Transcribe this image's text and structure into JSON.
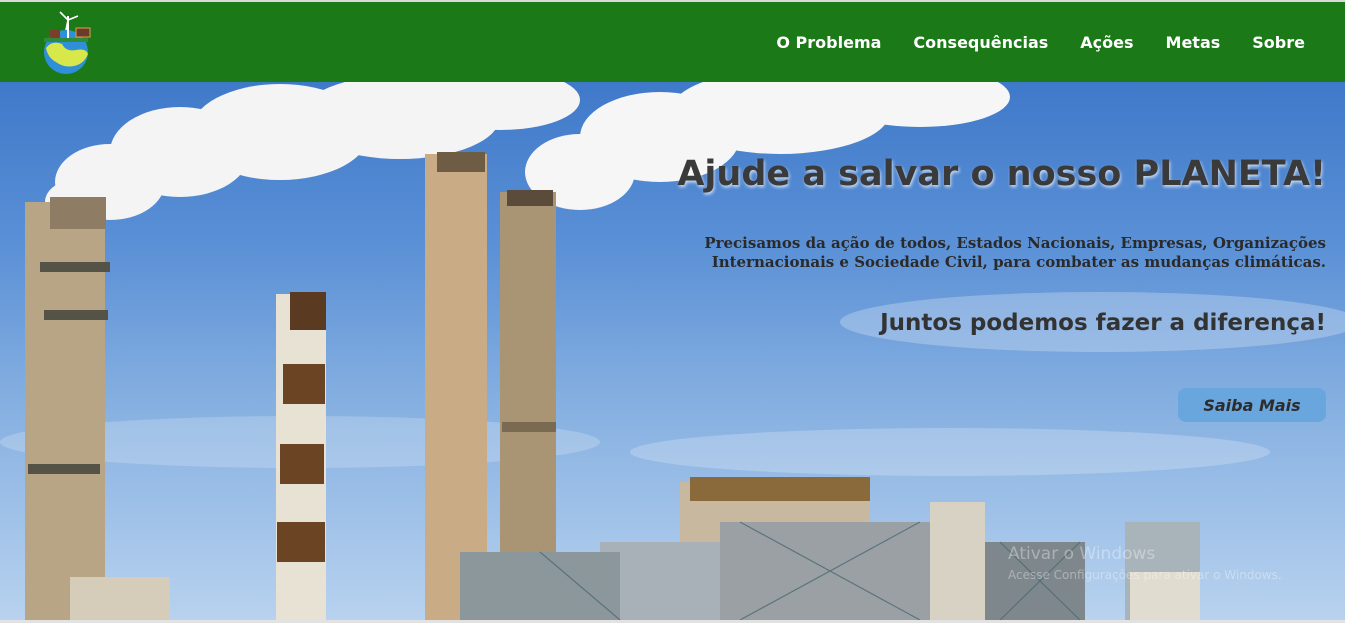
{
  "nav": {
    "items": [
      {
        "label": "O Problema"
      },
      {
        "label": "Consequências"
      },
      {
        "label": "Ações"
      },
      {
        "label": "Metas"
      },
      {
        "label": "Sobre"
      }
    ]
  },
  "hero": {
    "headline": "Ajude a salvar o nosso PLANETA!",
    "subtext": "Precisamos da ação de todos, Estados Nacionais, Empresas, Organizações Internacionais e Sociedade Civil, para combater as mudanças climáticas.",
    "tagline": "Juntos podemos fazer a diferença!",
    "cta_label": "Saiba Mais"
  },
  "watermark": {
    "title": "Ativar o Windows",
    "subtitle": "Acesse Configurações para ativar o Windows."
  },
  "colors": {
    "header_bg": "#1b7a17",
    "nav_text": "#ffffff",
    "button_bg": "#6aa6de",
    "sky": "#5a90d6"
  },
  "icons": {
    "logo": "earth-with-wind-turbine-and-solar-panel-logo"
  }
}
